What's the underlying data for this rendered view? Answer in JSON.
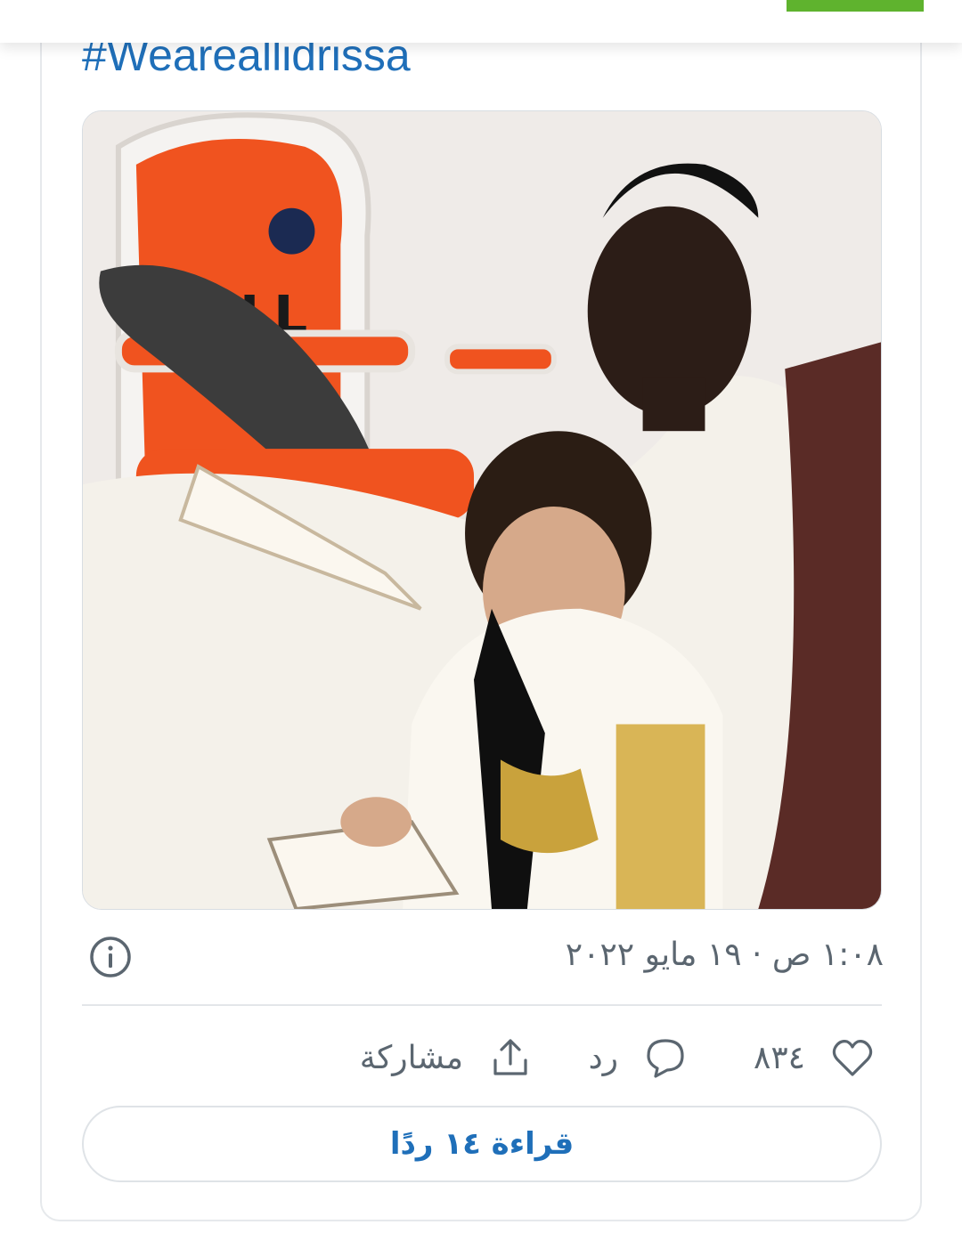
{
  "tweet": {
    "hashtag": "#Weareallidrissa",
    "image_alt": "photo of a man reading a book with a young child",
    "timestamp": "١:٠٨ ص · ١٩ مايو ٢٠٢٢"
  },
  "actions": {
    "like_count": "٨٣٤",
    "reply_label": "رد",
    "share_label": "مشاركة"
  },
  "read_replies_label": "قراءة ١٤ ردًا",
  "icons": {
    "info": "info-icon",
    "like": "heart-icon",
    "reply": "speech-bubble-icon",
    "share": "share-upload-icon"
  },
  "colors": {
    "link_blue": "#1f6fb9",
    "text_gray": "#5b6670",
    "accent_green": "#5fb32e"
  }
}
